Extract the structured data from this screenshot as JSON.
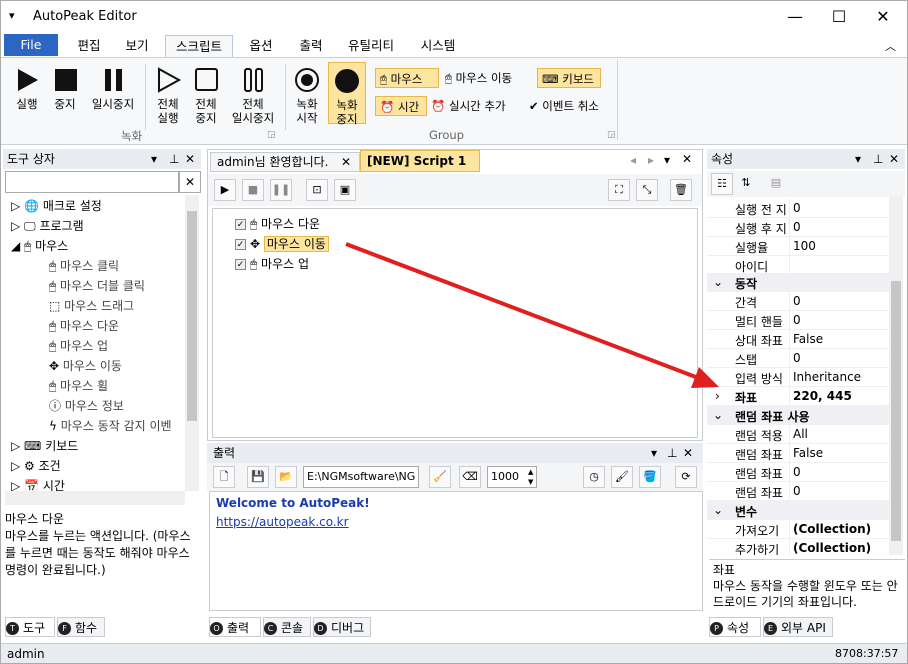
{
  "window": {
    "title": "AutoPeak Editor"
  },
  "menu_tabs": [
    "File",
    "편집",
    "보기",
    "스크립트",
    "옵션",
    "출력",
    "유틸리티",
    "시스템"
  ],
  "ribbon": {
    "run": "실행",
    "stop": "중지",
    "pause": "일시중지",
    "all_run": [
      "전체",
      "실행"
    ],
    "all_stop": [
      "전체",
      "중지"
    ],
    "all_pause": [
      "전체",
      "일시중지"
    ],
    "rec_start": [
      "녹화",
      "시작"
    ],
    "rec_stop": [
      "녹화",
      "중지"
    ],
    "group_rec": "녹화",
    "group_group": "Group",
    "mouse": "마우스",
    "mouse_move": "마우스 이동",
    "keyboard": "키보드",
    "time": "시간",
    "realtime_add": "실시간 추가",
    "event_cancel": "이벤트 취소"
  },
  "toolbox": {
    "title": "도구 상자",
    "items": [
      "매크로 설정",
      "프로그램",
      "마우스",
      "마우스 클릭",
      "마우스 더블 클릭",
      "마우스 드래그",
      "마우스 다운",
      "마우스 업",
      "마우스 이동",
      "마우스 휠",
      "마우스 정보",
      "마우스 동작 감지 이벤",
      "키보드",
      "조건",
      "시간"
    ],
    "desc_title": "마우스 다운",
    "desc": "마우스를 누르는 액션입니다. (마우스를 누르면 때는 동작도 해줘야 마우스 명령이 완료됩니다.)",
    "tab_tool": "도구",
    "tab_func": "함수"
  },
  "doc_tabs": {
    "welcome": "admin님 환영합니다.",
    "script": "[NEW] Script 1"
  },
  "script_lines": [
    "마우스 다운",
    "마우스 이동",
    "마우스 업"
  ],
  "output": {
    "title": "출력",
    "path": "E:\\NGMsoftware\\NG",
    "number": "1000",
    "welcome": "Welcome to AutoPeak!",
    "link": "https://autopeak.co.kr",
    "tab_out": "출력",
    "tab_console": "콘솔",
    "tab_debug": "디버그"
  },
  "props": {
    "title": "속성",
    "rows": [
      {
        "k": "실행 전 지",
        "v": "0"
      },
      {
        "k": "실행 후 지",
        "v": "0"
      },
      {
        "k": "실행율",
        "v": "100"
      },
      {
        "k": "아이디",
        "v": ""
      }
    ],
    "cat_action": "동작",
    "rows2": [
      {
        "k": "간격",
        "v": "0"
      },
      {
        "k": "멀티 핸들",
        "v": "0"
      },
      {
        "k": "상대 좌표",
        "v": "False"
      },
      {
        "k": "스탭",
        "v": "0"
      },
      {
        "k": "입력 방식",
        "v": "Inheritance"
      },
      {
        "k": "좌표",
        "v": "220, 445"
      }
    ],
    "cat_random": "랜덤 좌표 사용",
    "rows3": [
      {
        "k": "랜덤 적용",
        "v": "All"
      },
      {
        "k": "랜덤 좌표",
        "v": "False"
      },
      {
        "k": "랜덤 좌표",
        "v": "0"
      },
      {
        "k": "랜덤 좌표",
        "v": "0"
      }
    ],
    "cat_var": "변수",
    "rows4": [
      {
        "k": "가져오기",
        "v": "(Collection)"
      },
      {
        "k": "추가하기",
        "v": "(Collection)"
      }
    ],
    "desc_title": "좌표",
    "desc": "마우스 동작을 수행할 윈도우 또는 안드로이드 기기의 좌표입니다.",
    "tab_prop": "속성",
    "tab_api": "외부 API"
  },
  "status": {
    "user": "admin",
    "time": "8708:37:57"
  },
  "colors": {
    "file_tab": "#2b66c4",
    "highlight": "#fde5a0",
    "arrow": "#e02020",
    "link": "#1a3cb0"
  }
}
